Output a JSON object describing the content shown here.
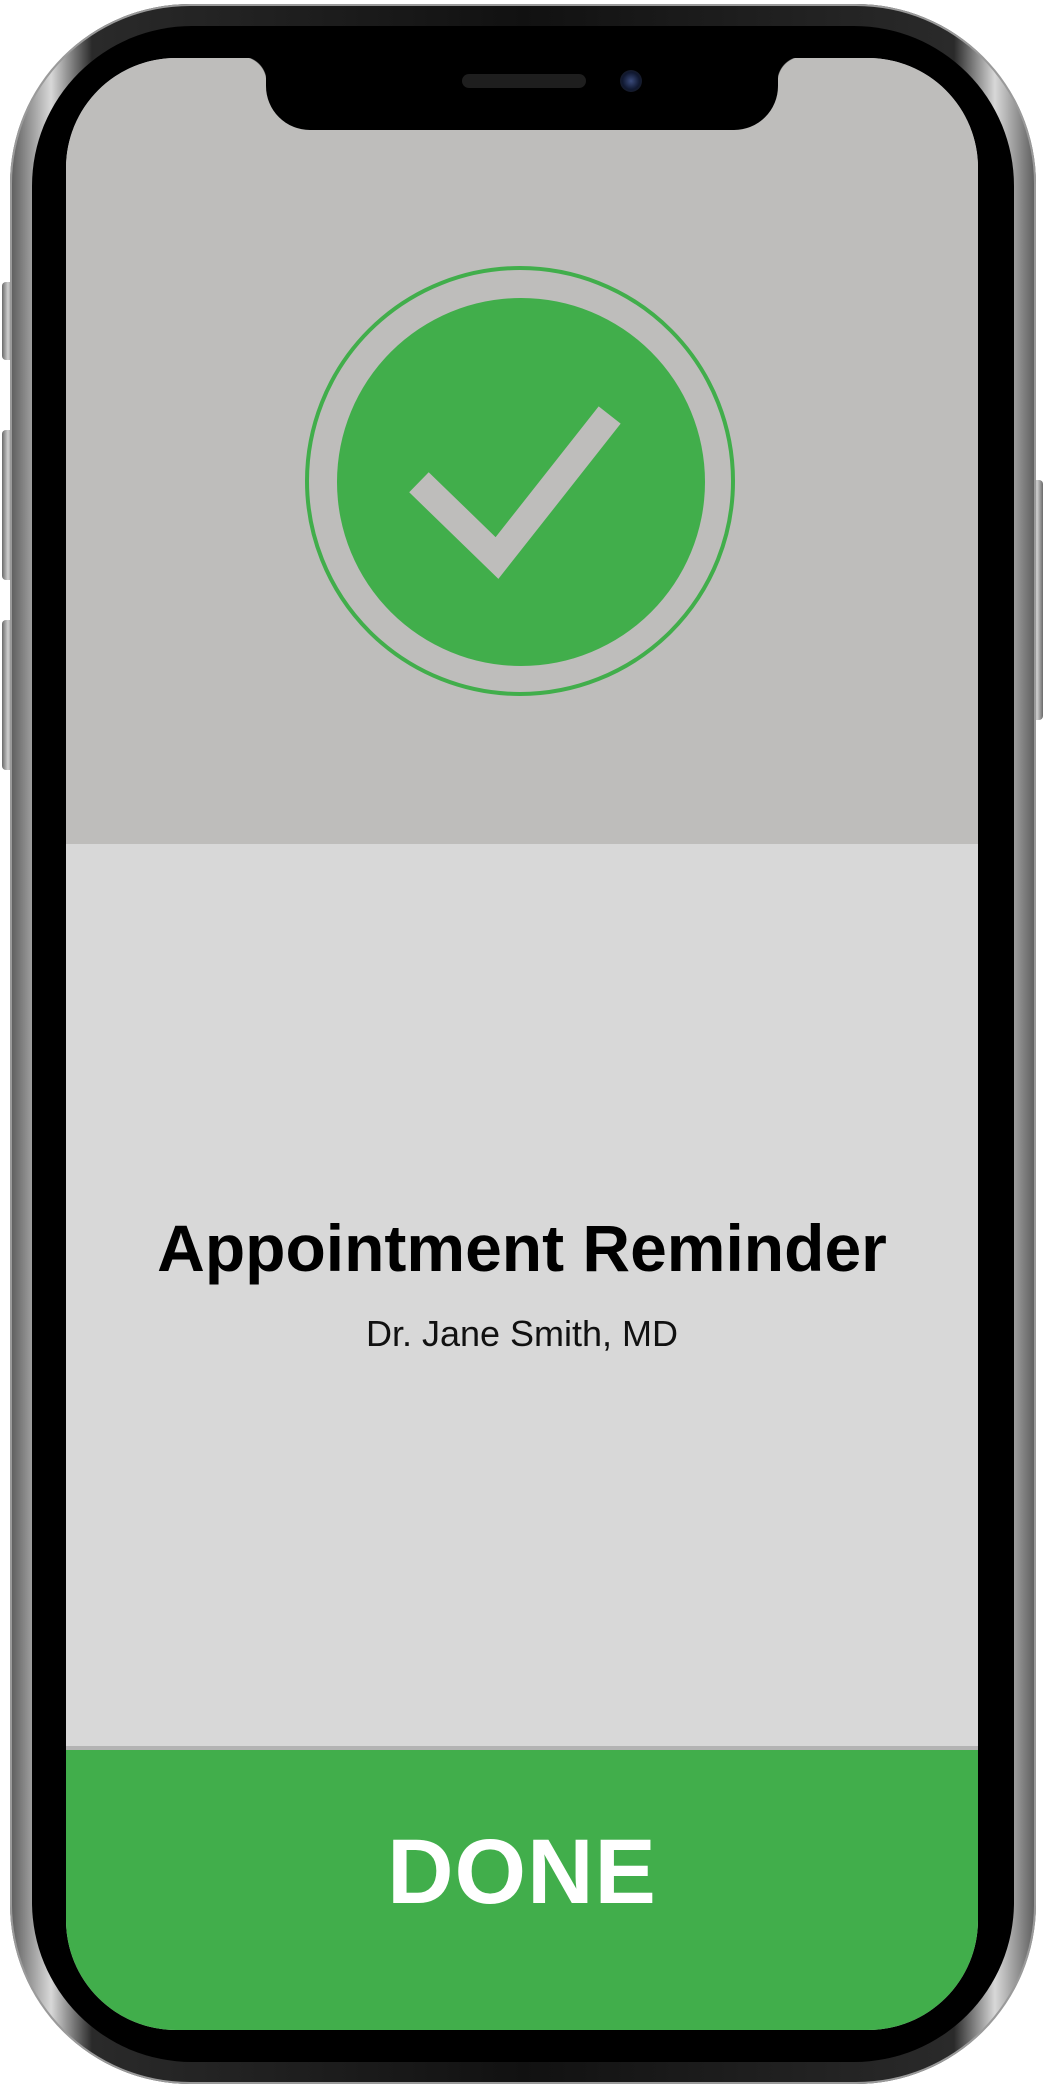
{
  "confirmation": {
    "icon": "checkmark-icon",
    "accent_color": "#41ae4b",
    "panel_color": "#bebdbb"
  },
  "content": {
    "title": "Appointment Reminder",
    "subtitle": "Dr. Jane Smith, MD"
  },
  "actions": {
    "done_label": "DONE",
    "done_color": "#41ae4b"
  }
}
